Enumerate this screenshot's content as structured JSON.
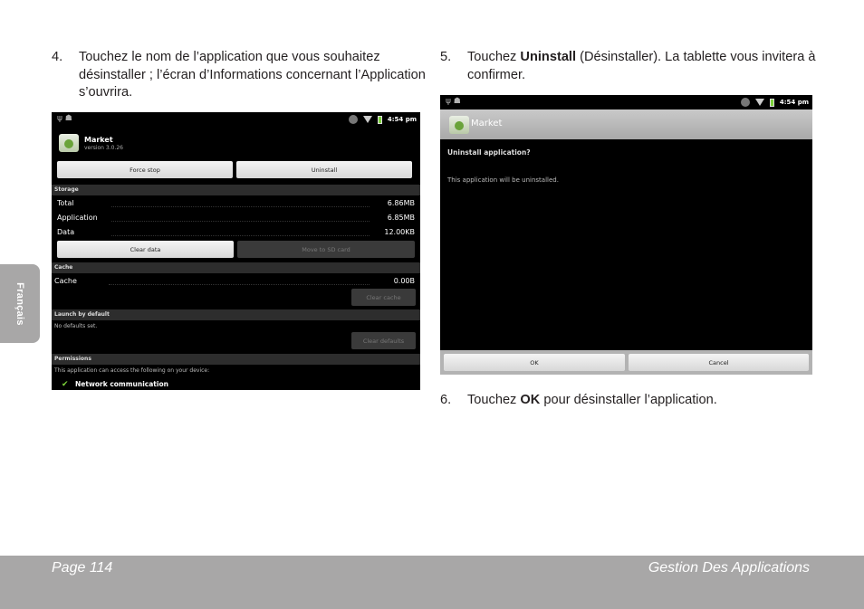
{
  "steps": {
    "s4": {
      "num": "4.",
      "text": "Touchez le nom de l’application que vous souhaitez désinstaller ; l’écran d’Informations concernant l’Application s’ouvrira."
    },
    "s5": {
      "num": "5.",
      "pre": "Touchez ",
      "bold": "Uninstall",
      "post": " (Désinstaller). La tablette vous invitera à confirmer."
    },
    "s6": {
      "num": "6.",
      "pre": "Touchez ",
      "bold": "OK",
      "post": " pour désinstaller l’application."
    }
  },
  "side_tab": "Français",
  "footer": {
    "page": "Page 114",
    "section": "Gestion Des Applications"
  },
  "shot1": {
    "time": "4:54 pm",
    "app_name": "Market",
    "version": "version 3.0.26",
    "force_stop": "Force stop",
    "uninstall": "Uninstall",
    "storage_header": "Storage",
    "rows": [
      {
        "label": "Total",
        "value": "6.86MB"
      },
      {
        "label": "Application",
        "value": "6.85MB"
      },
      {
        "label": "Data",
        "value": "12.00KB"
      }
    ],
    "clear_data": "Clear data",
    "move_sd": "Move to SD card",
    "cache_header": "Cache",
    "cache_label": "Cache",
    "cache_value": "0.00B",
    "clear_cache": "Clear cache",
    "launch_header": "Launch by default",
    "no_defaults": "No defaults set.",
    "clear_defaults": "Clear defaults",
    "permissions_header": "Permissions",
    "permissions_text": "This application can access the following on your device:",
    "network": "Network communication"
  },
  "shot2": {
    "time": "4:54 pm",
    "app_name": "Market",
    "dialog_title": "Uninstall application?",
    "dialog_message": "This application will be uninstalled.",
    "ok": "OK",
    "cancel": "Cancel"
  }
}
